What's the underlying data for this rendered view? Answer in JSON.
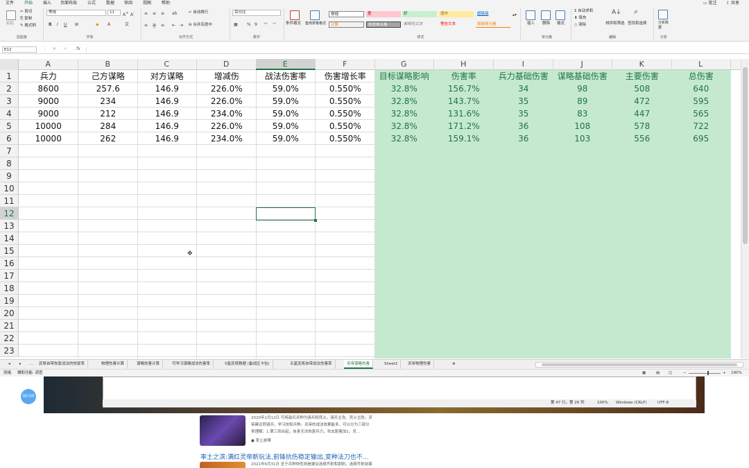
{
  "menu": {
    "tabs": [
      "文件",
      "开始",
      "插入",
      "页面布局",
      "公式",
      "数据",
      "审阅",
      "视图",
      "帮助"
    ],
    "active_tab": "开始",
    "comments": "批注",
    "share": "共享"
  },
  "ribbon": {
    "clipboard": {
      "paste": "粘贴",
      "cut": "剪切",
      "copy": "复制",
      "format_painter": "格式刷",
      "label": "剪贴板"
    },
    "font": {
      "name": "等线",
      "size": "11",
      "label": "字体"
    },
    "alignment": {
      "wrap": "自动换行",
      "merge": "合并后居中",
      "label": "对齐方式"
    },
    "number": {
      "format": "百分比",
      "label": "数字"
    },
    "styles": {
      "conditional": "条件格式",
      "table": "套用表格格式",
      "label": "样式",
      "cells": [
        "常规",
        "差",
        "好",
        "适中",
        "超链接",
        "计算",
        "检查单元格",
        "解释性文本",
        "警告文本",
        "链接单元格"
      ]
    },
    "cells": {
      "insert": "插入",
      "delete": "删除",
      "format": "格式",
      "label": "单元格"
    },
    "editing": {
      "autosum": "自动求和",
      "fill": "填充",
      "clear": "清除",
      "sort": "排序和筛选",
      "find": "查找和选择",
      "label": "编辑"
    },
    "analysis": {
      "analyze": "分析数据",
      "label": "分析"
    }
  },
  "formula_bar": {
    "name_box": "E12",
    "formula": ""
  },
  "columns": [
    "A",
    "B",
    "C",
    "D",
    "E",
    "F",
    "G",
    "H",
    "I",
    "J",
    "K",
    "L"
  ],
  "rows": [
    "1",
    "2",
    "3",
    "4",
    "5",
    "6",
    "7",
    "8",
    "9",
    "10",
    "11",
    "12",
    "13",
    "14",
    "15",
    "16",
    "17",
    "18",
    "19",
    "20",
    "21",
    "22",
    "23"
  ],
  "table": {
    "headers": [
      "兵力",
      "己方谋略",
      "对方谋略",
      "增减伤",
      "战法伤害率",
      "伤害增长率",
      "目标谋略影响",
      "伤害率",
      "兵力基础伤害",
      "谋略基础伤害",
      "主要伤害",
      "总伤害"
    ],
    "data": [
      [
        "8600",
        "257.6",
        "146.9",
        "226.0%",
        "59.0%",
        "0.550%",
        "32.8%",
        "156.7%",
        "34",
        "98",
        "508",
        "640"
      ],
      [
        "9000",
        "234",
        "146.9",
        "226.0%",
        "59.0%",
        "0.550%",
        "32.8%",
        "143.7%",
        "35",
        "89",
        "472",
        "595"
      ],
      [
        "9000",
        "212",
        "146.9",
        "234.0%",
        "59.0%",
        "0.550%",
        "32.8%",
        "131.6%",
        "35",
        "83",
        "447",
        "565"
      ],
      [
        "10000",
        "284",
        "146.9",
        "226.0%",
        "59.0%",
        "0.550%",
        "32.8%",
        "171.2%",
        "36",
        "108",
        "578",
        "722"
      ],
      [
        "10000",
        "262",
        "146.9",
        "234.0%",
        "59.0%",
        "0.550%",
        "32.8%",
        "159.1%",
        "36",
        "103",
        "556",
        "695"
      ]
    ]
  },
  "sheet_tabs": [
    "武将自带恢复战法的恢复率",
    "物理伤害计算",
    "谋略伤害计算",
    "可学习谋略战法伤害率",
    "5星武将数据 (备战区卡包)",
    "五星武将自带战法伤害率",
    "灵帝谋略伤害",
    "Sheet2",
    "灵帝物理伤害"
  ],
  "active_sheet": "灵帝谋略伤害",
  "status": {
    "ready": "就绪",
    "accessibility": "辅助功能: 调查",
    "zoom": "190%"
  },
  "below": {
    "timer": "00:00",
    "notepad_status": {
      "pos": "第 47 行，第 26 列",
      "zoom": "100%",
      "eol": "Windows (CRLF)",
      "enc": "UTF-8"
    },
    "article1": {
      "line1": "2020年1月12日 可将敌兵兵种为骑兵和死士。骑兵主攻、死士主防。灵",
      "line2": "帝建议转骑兵，学习技和兵种。灵帝的战法效果能多，可以分为三部分",
      "line3": "来理解：1.第三回合起，自身无法恢复兵力，攻击距离加1。灵...",
      "author": "率土游博"
    },
    "article2": {
      "title": "率土之滨:满红灵帝新玩法,前锋抗伤稳定输出,变种法刀也不...",
      "line1": "2021年6月31日 至于兵种特性则是建议选择齐射和割射，选择齐射前面"
    }
  }
}
